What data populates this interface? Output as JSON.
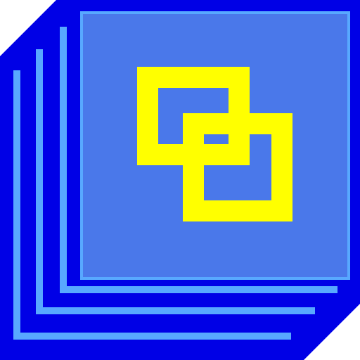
{
  "icon": {
    "name": "stacked-pages-linked-squares-icon",
    "colors": {
      "background": "#ffffff",
      "border_blue": "#0000e6",
      "page_fill": "#4a78ea",
      "page_lines": "#58a8ff",
      "symbol_yellow": "#ffff00"
    }
  }
}
